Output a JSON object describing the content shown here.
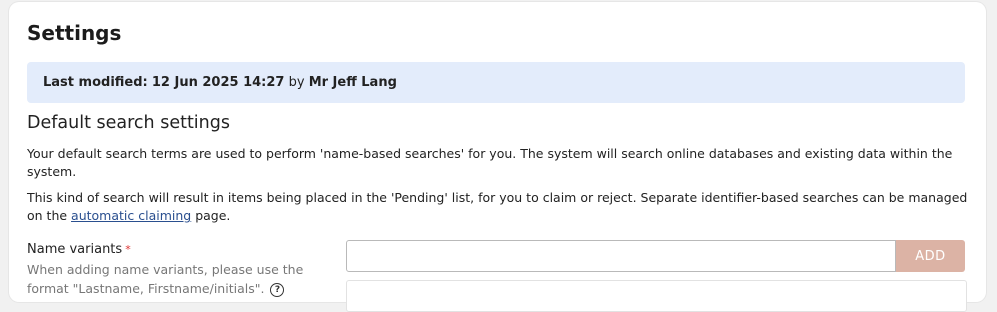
{
  "page": {
    "title": "Settings"
  },
  "info_banner": {
    "prefix": "Last modified:",
    "date": "12 Jun 2025 14:27",
    "by_word": "by",
    "user": "Mr Jeff Lang"
  },
  "section": {
    "title": "Default search settings",
    "paragraph1": "Your default search terms are used to perform 'name-based searches' for you. The system will search online databases and existing data within the system.",
    "paragraph2_before": "This kind of search will result in items being placed in the 'Pending' list, for you to claim or reject. Separate identifier-based searches can be managed on the ",
    "paragraph2_link": "automatic claiming",
    "paragraph2_after": " page."
  },
  "name_variants": {
    "label": "Name variants",
    "required_mark": "*",
    "hint": "When adding name variants, please use the format \"Lastname, Firstname/initials\".",
    "help_icon": "?",
    "input_value": "",
    "add_label": "ADD"
  },
  "colors": {
    "banner_bg": "#e3ecfb",
    "add_button": "#dcb3a5",
    "link": "#2a4f8f",
    "required": "#dd3333"
  },
  "icons": {
    "help": "question-circle-icon"
  }
}
